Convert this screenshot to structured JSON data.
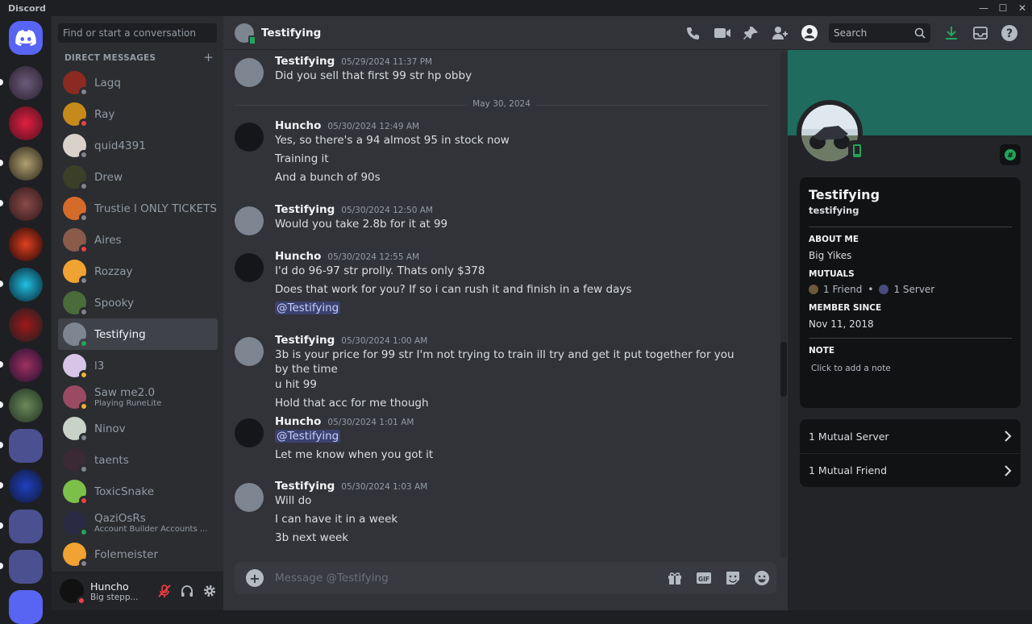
{
  "window": {
    "app_name": "Discord"
  },
  "dm_sidebar": {
    "search_placeholder": "Find or start a conversation",
    "header": "DIRECT MESSAGES",
    "add_label": "+",
    "dms": [
      {
        "name": "Lagq",
        "status": "offline",
        "color": "#8a2a20"
      },
      {
        "name": "Ray",
        "status": "dnd",
        "color": "#c58a1a"
      },
      {
        "name": "quid4391",
        "status": "offline",
        "color": "#d8d2cb"
      },
      {
        "name": "Drew",
        "status": "offline",
        "color": "#3c3f27"
      },
      {
        "name": "Trustie l ONLY TICKETS",
        "status": "offline",
        "color": "#d46b2a"
      },
      {
        "name": "Aires",
        "status": "dnd",
        "color": "#8a5a4a"
      },
      {
        "name": "Rozzay",
        "status": "offline",
        "color": "#f0a232"
      },
      {
        "name": "Spooky",
        "status": "offline",
        "color": "#4b6b3a"
      },
      {
        "name": "Testifying",
        "status": "online",
        "color": "#7d8591"
      },
      {
        "name": "l3",
        "status": "idle",
        "color": "#d8c4e6"
      },
      {
        "name": "Saw me2.0",
        "sub": "Playing RuneLite",
        "status": "idle",
        "color": "#9a4a62"
      },
      {
        "name": "Ninov",
        "status": "offline",
        "color": "#c9d2c6"
      },
      {
        "name": "taents",
        "status": "offline",
        "color": "#3a2a35"
      },
      {
        "name": "ToxicSnake",
        "status": "dnd",
        "color": "#7cc04a"
      },
      {
        "name": "QaziOsRs",
        "sub": "Account Builder Accounts ...",
        "status": "online",
        "color": "#2a2a45"
      },
      {
        "name": "Folemeister",
        "status": "offline",
        "color": "#f0a232"
      }
    ]
  },
  "user_bar": {
    "name": "Huncho",
    "status_text": "Big stepp..."
  },
  "header": {
    "title": "Testifying",
    "search_placeholder": "Search"
  },
  "chat": {
    "date_divider": "May 30, 2024",
    "messages": [
      {
        "author": "Testifying",
        "time": "05/29/2024 11:37 PM",
        "lines": [
          "Did you sell that first 99 str hp obby"
        ]
      },
      {
        "author": "Huncho",
        "time": "05/30/2024 12:49 AM",
        "lines": [
          "Yes, so there's a 94 almost 95 in stock now",
          "Training it",
          "And a bunch of 90s"
        ]
      },
      {
        "author": "Testifying",
        "time": "05/30/2024 12:50 AM",
        "lines": [
          "Would you take 2.8b for it at 99"
        ]
      },
      {
        "author": "Huncho",
        "time": "05/30/2024 12:55 AM",
        "lines": [
          "I'd do 96-97 str prolly. Thats only $378",
          "Does that work for you? If so i can rush it and finish in a few days",
          "@Testifying"
        ]
      },
      {
        "author": "Testifying",
        "time": "05/30/2024 1:00 AM",
        "lines": [
          "3b is your price for 99 str I'm not trying to train ill try and get it put together for you by the time",
          "u hit 99",
          "Hold that acc for me though"
        ]
      },
      {
        "author": "Huncho",
        "time": "05/30/2024 1:01 AM",
        "lines": [
          "@Testifying",
          "Let me know when you got it"
        ]
      },
      {
        "author": "Testifying",
        "time": "05/30/2024 1:03 AM",
        "lines": [
          "Will do",
          "I can have it in a week",
          "3b next week"
        ]
      }
    ],
    "composer_placeholder": "Message @Testifying"
  },
  "profile": {
    "display_name": "Testifying",
    "username": "testifying",
    "about_label": "ABOUT ME",
    "about": "Big Yikes",
    "mutuals_label": "MUTUALS",
    "mutual_friends": "1 Friend",
    "mutual_servers": "1 Server",
    "member_since_label": "MEMBER SINCE",
    "member_since": "Nov 11, 2018",
    "note_label": "NOTE",
    "note_placeholder": "Click to add a note",
    "rows": [
      "1 Mutual Server",
      "1 Mutual Friend"
    ],
    "banner_color": "#1f6b5e"
  },
  "colors": {
    "accent": "#5865f2",
    "online": "#23a55a",
    "dnd": "#f23f43",
    "idle": "#f0b232",
    "offline": "#80848e"
  }
}
